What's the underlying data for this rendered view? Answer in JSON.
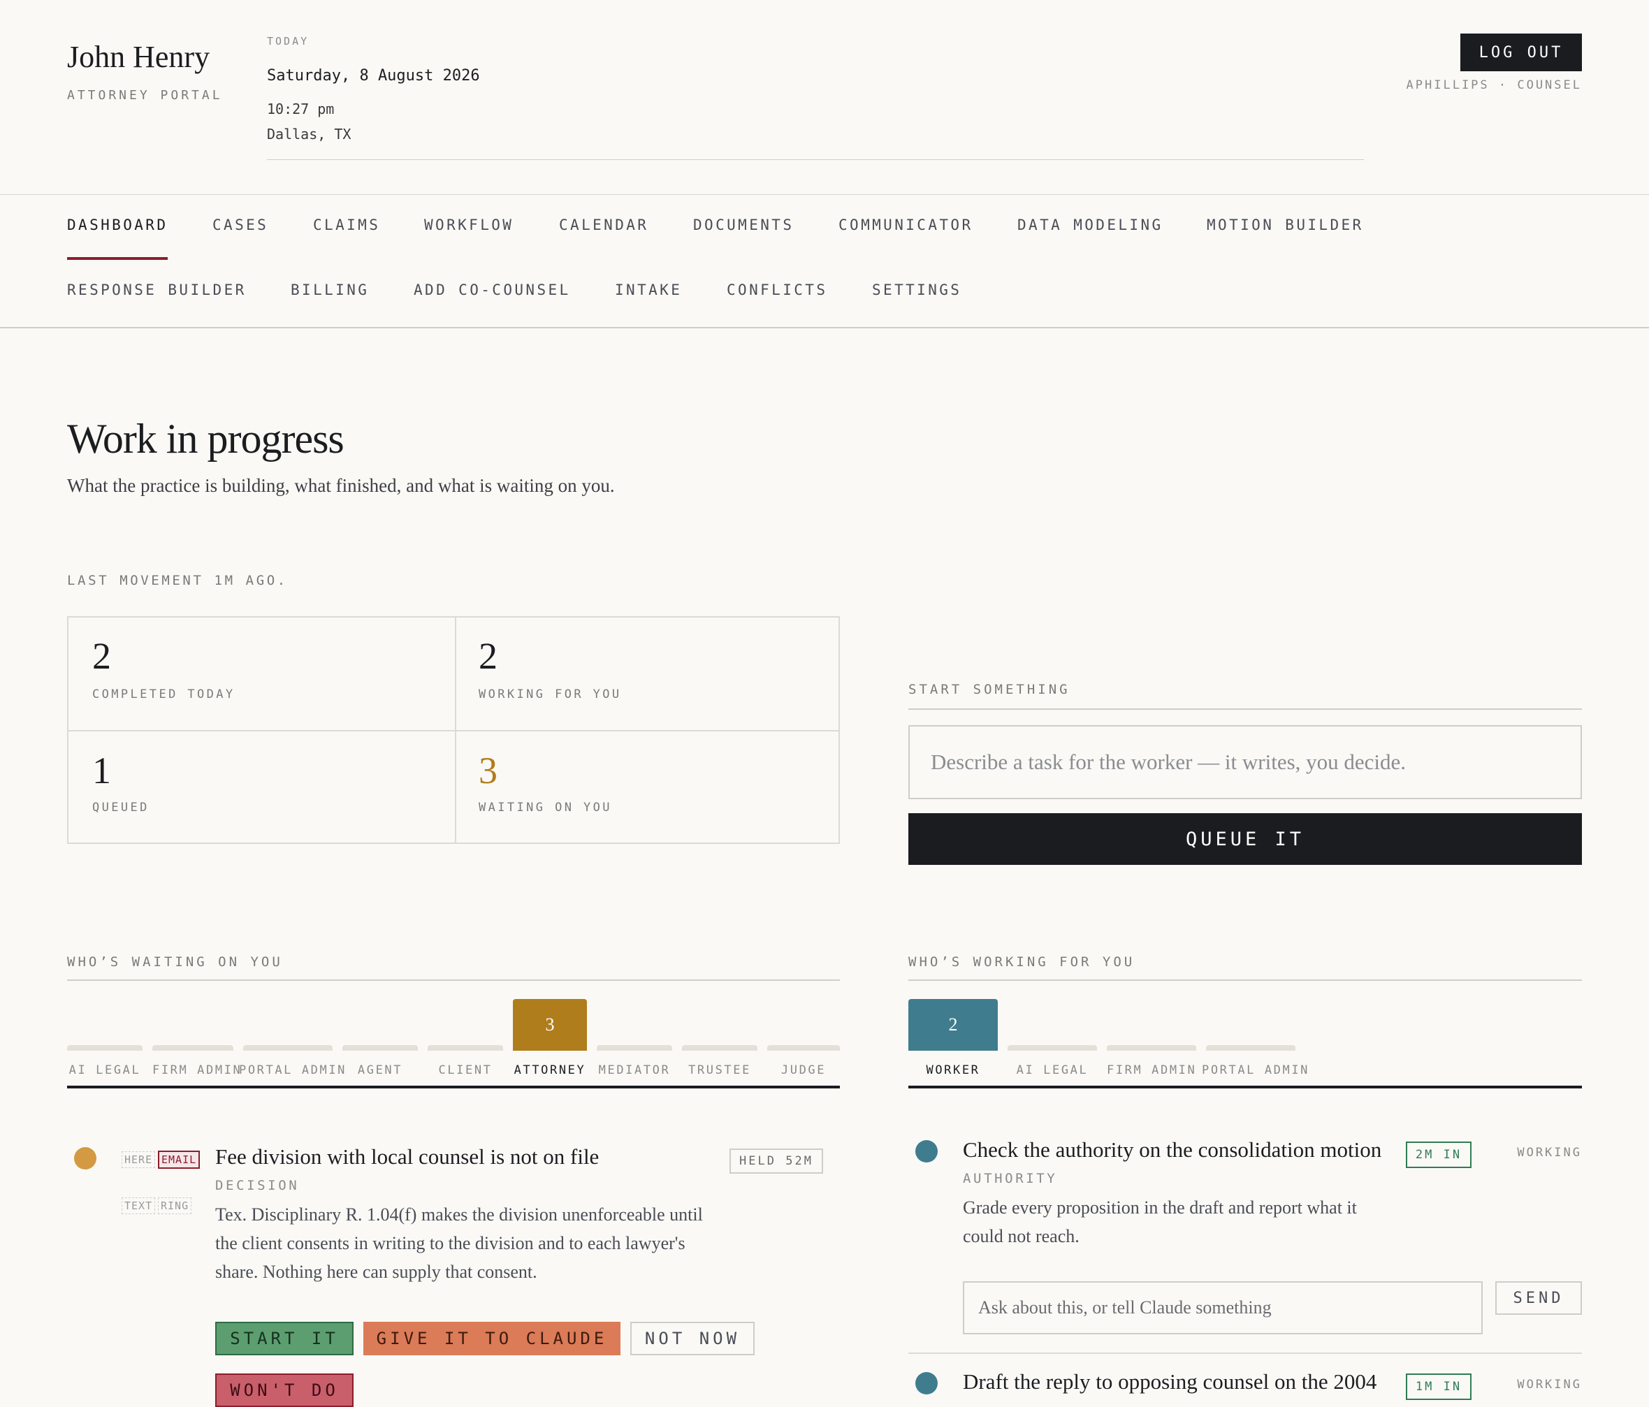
{
  "header": {
    "name": "John Henry",
    "portal": "ATTORNEY PORTAL",
    "today_label": "TODAY",
    "date": "Saturday, 8 August 2026",
    "time": "10:27 pm",
    "location": "Dallas, TX",
    "logout_label": "LOG OUT",
    "user_role": "APHILLIPS · COUNSEL"
  },
  "nav": {
    "row1": [
      "DASHBOARD",
      "CASES",
      "CLAIMS",
      "WORKFLOW",
      "CALENDAR",
      "DOCUMENTS",
      "COMMUNICATOR",
      "DATA MODELING",
      "MOTION BUILDER"
    ],
    "row2": [
      "RESPONSE BUILDER",
      "BILLING",
      "ADD CO-COUNSEL",
      "INTAKE",
      "CONFLICTS",
      "SETTINGS"
    ],
    "active": "DASHBOARD",
    "accent_color": "#8d1d2c"
  },
  "page": {
    "title": "Work in progress",
    "subtitle": "What the practice is building, what finished, and what is waiting on you.",
    "last_movement": "LAST MOVEMENT 1M AGO."
  },
  "stats": [
    {
      "value": "2",
      "label": "COMPLETED TODAY"
    },
    {
      "value": "2",
      "label": "WORKING FOR YOU"
    },
    {
      "value": "1",
      "label": "QUEUED"
    },
    {
      "value": "3",
      "label": "WAITING ON YOU",
      "color": "#b07d1c"
    }
  ],
  "start": {
    "label": "START SOMETHING",
    "placeholder": "Describe a task for the worker — it writes, you decide.",
    "button": "QUEUE IT"
  },
  "waiting": {
    "label": "WHO’S WAITING ON YOU",
    "tabs": [
      {
        "label": "AI LEGAL",
        "count": ""
      },
      {
        "label": "FIRM ADMIN",
        "count": ""
      },
      {
        "label": "PORTAL ADMIN",
        "count": ""
      },
      {
        "label": "AGENT",
        "count": ""
      },
      {
        "label": "CLIENT",
        "count": ""
      },
      {
        "label": "ATTORNEY",
        "count": "3",
        "active": true,
        "color": "#b07d1c"
      },
      {
        "label": "MEDIATOR",
        "count": ""
      },
      {
        "label": "TRUSTEE",
        "count": ""
      },
      {
        "label": "JUDGE",
        "count": ""
      }
    ],
    "item": {
      "channels": [
        "HERE",
        "EMAIL",
        "TEXT",
        "RING"
      ],
      "title": "Fee division with local counsel is not on file",
      "tag": "DECISION",
      "held": "HELD 52M",
      "body": "Tex. Disciplinary R. 1.04(f) makes the division unenforceable until the client consents in writing to the division and to each lawyer's share. Nothing here can supply that consent.",
      "actions": [
        "START IT",
        "GIVE IT TO CLAUDE",
        "NOT NOW",
        "WON'T DO"
      ],
      "dot_color": "#d39a43"
    }
  },
  "working": {
    "label": "WHO’S WORKING FOR YOU",
    "tabs": [
      {
        "label": "WORKER",
        "count": "2",
        "active": true,
        "color": "#3f7d8e"
      },
      {
        "label": "AI LEGAL",
        "count": ""
      },
      {
        "label": "FIRM ADMIN",
        "count": ""
      },
      {
        "label": "PORTAL ADMIN",
        "count": ""
      }
    ],
    "items": [
      {
        "title": "Check the authority on the consolidation motion",
        "tag": "AUTHORITY",
        "elapsed": "2M IN",
        "status": "WORKING",
        "body": "Grade every proposition in the draft and report what it could not reach.",
        "ask_placeholder": "Ask about this, or tell Claude something",
        "send": "SEND"
      },
      {
        "title": "Draft the reply to opposing counsel on the 2004",
        "elapsed": "1M IN",
        "status": "WORKING"
      }
    ],
    "dot_color": "#3f7d8e"
  }
}
